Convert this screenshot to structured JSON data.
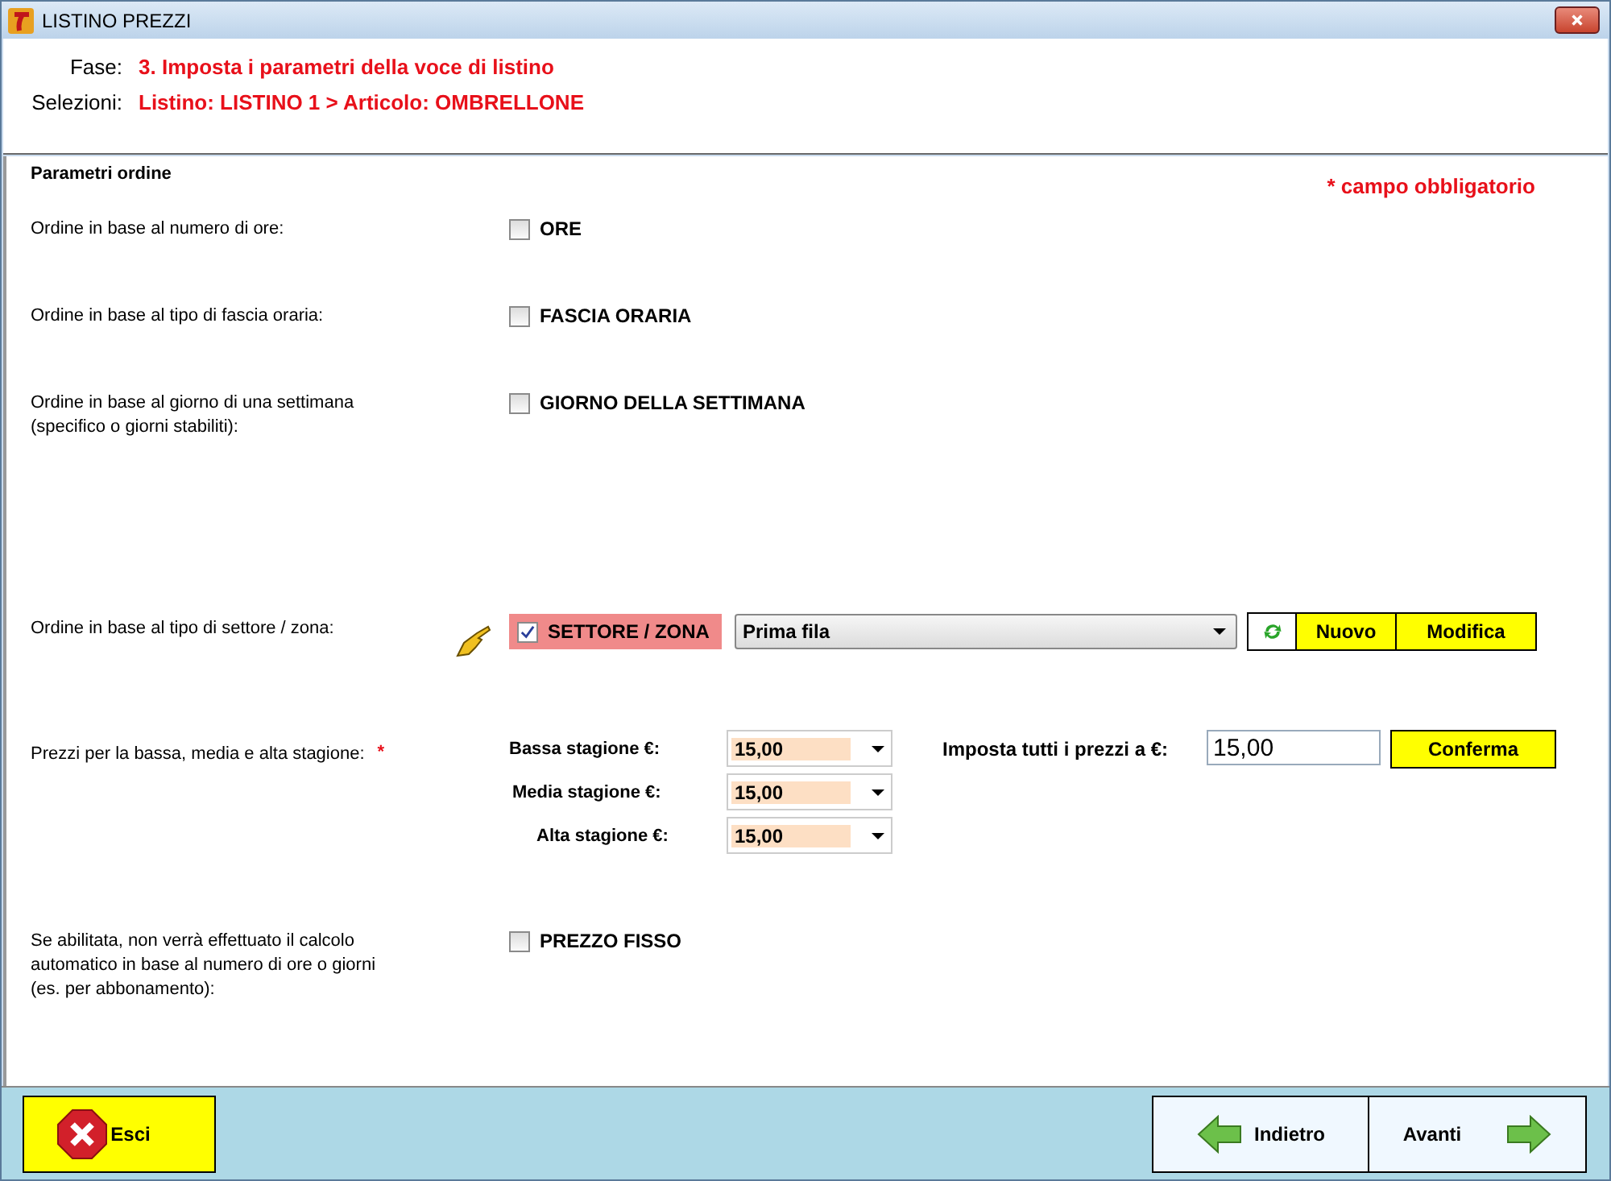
{
  "window": {
    "title": "LISTINO PREZZI"
  },
  "header": {
    "phase_label": "Fase:",
    "phase": "3. Imposta i parametri della voce di listino",
    "selections_label": "Selezioni:",
    "selections": "Listino: LISTINO 1 > Articolo: OMBRELLONE"
  },
  "section": {
    "title": "Parametri ordine",
    "required_note": "* campo obbligatorio"
  },
  "rows": [
    {
      "kind": "checkbox",
      "label": "Ordine in base al numero di ore:",
      "option": "ORE",
      "checked": false
    },
    {
      "kind": "checkbox",
      "label": "Ordine in base al tipo di fascia oraria:",
      "option": "FASCIA ORARIA",
      "checked": false
    },
    {
      "kind": "checkbox",
      "label": "Ordine in base al giorno di una settimana\n(specifico o giorni stabiliti):",
      "option": "GIORNO DELLA SETTIMANA",
      "checked": false
    },
    {
      "kind": "sector",
      "label": "Ordine in base al tipo di settore / zona:",
      "option": "SETTORE / ZONA",
      "checked": true,
      "dropdown": "Prima fila",
      "buttons": [
        "Nuovo",
        "Modifica"
      ]
    },
    {
      "kind": "prices",
      "label": "Prezzi per la bassa, media e alta stagione:",
      "required_mark": "*",
      "seasons": [
        {
          "label": "Bassa stagione €:",
          "value": "15,00"
        },
        {
          "label": "Media stagione €:",
          "value": "15,00"
        },
        {
          "label": "Alta stagione €:",
          "value": "15,00"
        }
      ],
      "set_all_label": "Imposta tutti i prezzi a €:",
      "set_all_value": "15,00",
      "confirm": "Conferma"
    },
    {
      "kind": "checkbox",
      "label": "Se abilitata, non verrà effettuato il calcolo\nautomatico in base al numero di ore o giorni\n(es. per abbonamento):",
      "option": "PREZZO FISSO",
      "checked": false
    }
  ],
  "footer": {
    "exit": "Esci",
    "back": "Indietro",
    "next": "Avanti"
  }
}
